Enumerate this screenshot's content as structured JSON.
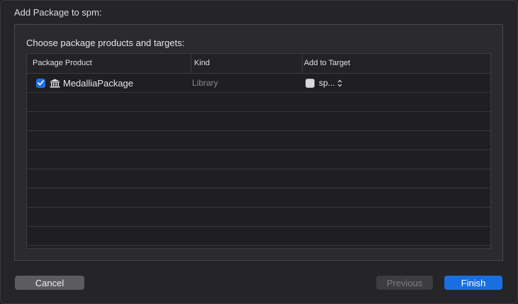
{
  "sheet": {
    "title": "Add Package to spm:"
  },
  "panel": {
    "heading": "Choose package products and targets:"
  },
  "table": {
    "columns": [
      "Package Product",
      "Kind",
      "Add to Target"
    ],
    "rows": [
      {
        "checked": true,
        "icon": "library-icon",
        "product": "MedalliaPackage",
        "kind": "Library",
        "target_checked": false,
        "target": "sp..."
      }
    ]
  },
  "footer": {
    "cancel_label": "Cancel",
    "previous_label": "Previous",
    "finish_label": "Finish"
  },
  "colors": {
    "accent": "#1a6fe0",
    "background": "#252528"
  }
}
